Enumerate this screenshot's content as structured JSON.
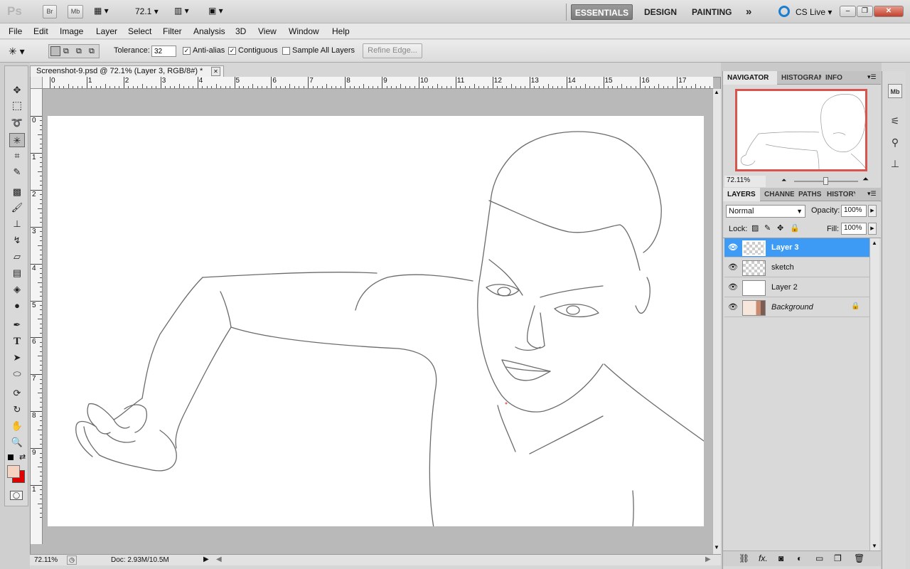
{
  "appbar": {
    "logo": "Ps",
    "bridge_label": "Br",
    "minibridge_label": "Mb",
    "zoom_value": "72.1",
    "workspaces": [
      "ESSENTIALS",
      "DESIGN",
      "PAINTING"
    ],
    "more_label": "»",
    "cslive_label": "CS Live",
    "win_minimize": "–",
    "win_restore": "❐",
    "win_close": "✕"
  },
  "menu": [
    "File",
    "Edit",
    "Image",
    "Layer",
    "Select",
    "Filter",
    "Analysis",
    "3D",
    "View",
    "Window",
    "Help"
  ],
  "options": {
    "tolerance_label": "Tolerance:",
    "tolerance_value": "32",
    "antialias_label": "Anti-alias",
    "antialias_checked": true,
    "contiguous_label": "Contiguous",
    "contiguous_checked": true,
    "sample_all_label": "Sample All Layers",
    "sample_all_checked": false,
    "refine_edge_label": "Refine Edge..."
  },
  "document": {
    "tab_title": "Screenshot-9.psd @ 72.1% (Layer 3, RGB/8#) *",
    "tab_close": "✕",
    "h_ruler_labels": [
      "0",
      "1",
      "2",
      "3",
      "4",
      "5",
      "6",
      "7",
      "8",
      "9",
      "10",
      "11",
      "12",
      "13",
      "14",
      "15",
      "16",
      "17"
    ],
    "v_ruler_labels": [
      "0",
      "1",
      "2",
      "3",
      "4",
      "5",
      "6",
      "7",
      "8",
      "9",
      "1"
    ]
  },
  "status": {
    "zoom": "72.11%",
    "doc_size": "Doc: 2.93M/10.5M"
  },
  "navigator": {
    "tabs": [
      "NAVIGATOR",
      "HISTOGRAM",
      "INFO"
    ],
    "zoom": "72.11%",
    "zoom_fraction": 0.5
  },
  "layers_panel": {
    "tabs": [
      "LAYERS",
      "CHANNELS",
      "PATHS",
      "HISTORY"
    ],
    "blend_mode": "Normal",
    "opacity_label": "Opacity:",
    "opacity_value": "100%",
    "lock_label": "Lock:",
    "fill_label": "Fill:",
    "fill_value": "100%",
    "layers": [
      {
        "name": "Layer 3",
        "selected": true,
        "thumb": "transparent"
      },
      {
        "name": "sketch",
        "selected": false,
        "thumb": "transparent"
      },
      {
        "name": "Layer 2",
        "selected": false,
        "thumb": "white"
      },
      {
        "name": "Background",
        "selected": false,
        "thumb": "image",
        "locked": true
      }
    ]
  },
  "colors": {
    "foreground": "#f5d3c0",
    "background": "#e00000",
    "selection": "#3e9bf5",
    "navigator_frame": "#d9534f"
  }
}
